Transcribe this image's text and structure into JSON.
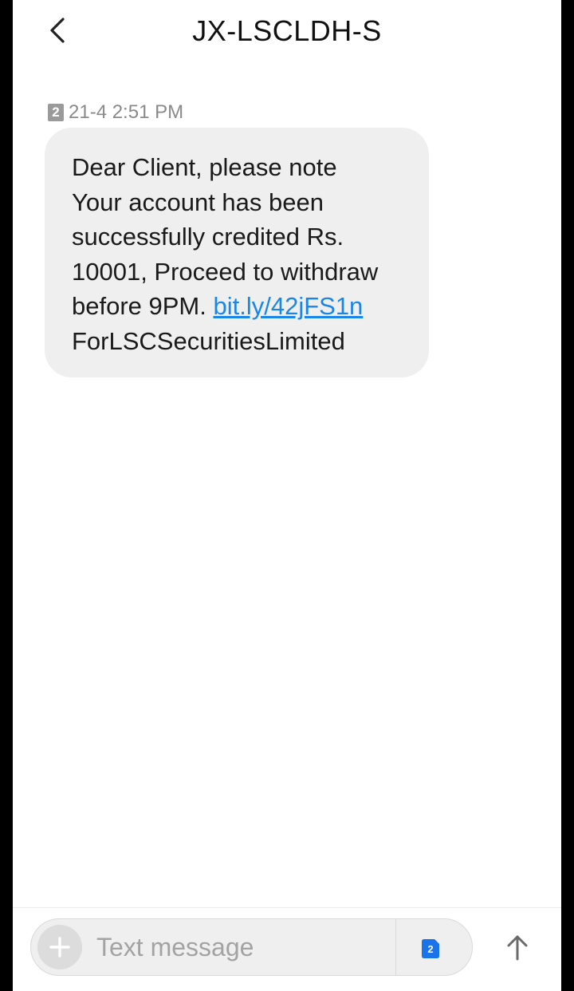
{
  "header": {
    "title": "JX-LSCLDH-S"
  },
  "message": {
    "sim_badge": "2",
    "timestamp": "21-4 2:51 PM",
    "lines": [
      "Dear Client, please note",
      "Your account has been",
      "successfully credited Rs.",
      "10001, Proceed to withdraw"
    ],
    "line5_prefix": "before 9PM. ",
    "link_text": "bit.ly/42jFS1n",
    "signature": "ForLSCSecuritiesLimited"
  },
  "composer": {
    "placeholder": "Text message",
    "sim_label": "2"
  },
  "colors": {
    "link": "#1a86e6",
    "sim_button": "#1a73e8",
    "bubble": "#efefef"
  },
  "icons": {
    "back": "chevron-left-icon",
    "attach": "plus-icon",
    "send": "arrow-up-icon"
  }
}
